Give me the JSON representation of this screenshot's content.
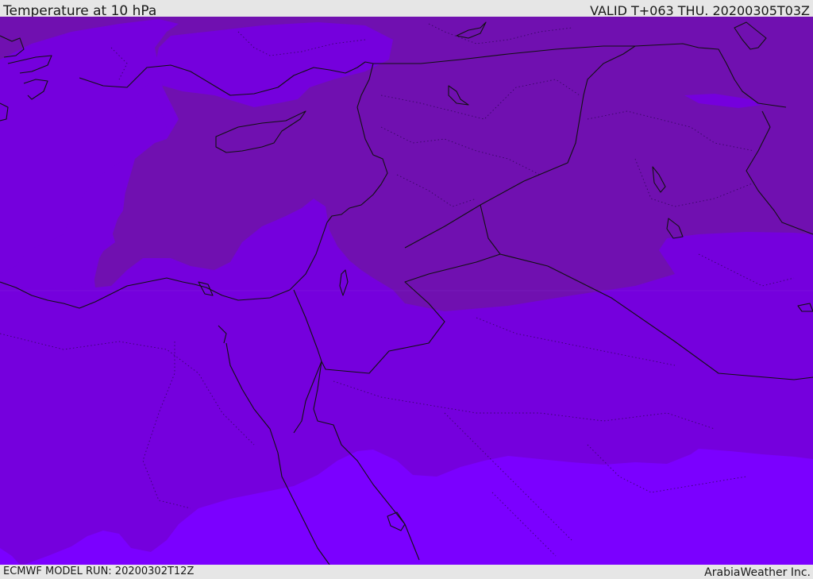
{
  "header": {
    "title": "Temperature at 10 hPa",
    "valid_time": "VALID T+063 THU. 20200305T03Z"
  },
  "footer": {
    "model_run": "ECMWF MODEL RUN: 20200302T12Z",
    "credit": "ArabiaWeather Inc."
  },
  "colors": {
    "band_darkest": "#7010b0",
    "band_mid": "#7500dd",
    "band_light": "#7b00ff",
    "coastline": "#111111",
    "frame": "#e6e6e6"
  }
}
